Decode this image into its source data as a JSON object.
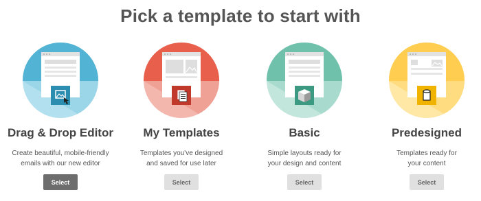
{
  "heading": "Pick a template to start with",
  "cards": [
    {
      "title": "Drag & Drop Editor",
      "desc_line1": "Create beautiful, mobile-friendly",
      "desc_line2": "emails with our new editor",
      "button": "Select",
      "icon": "image-picture-icon",
      "color_dark": "#52b3d4",
      "color_light": "#b2e0ef",
      "color_badge": "#2b8db0",
      "active": true
    },
    {
      "title": "My Templates",
      "desc_line1": "Templates you've designed",
      "desc_line2": "and saved for use later",
      "button": "Select",
      "icon": "documents-stack-icon",
      "color_dark": "#e8604c",
      "color_light": "#f3b7ae",
      "color_badge": "#c0392b",
      "active": false
    },
    {
      "title": "Basic",
      "desc_line1": "Simple layouts ready for",
      "desc_line2": "your design and content",
      "button": "Select",
      "icon": "cube-icon",
      "color_dark": "#6fc1ac",
      "color_light": "#c3e6dc",
      "color_badge": "#3d9a82",
      "active": false
    },
    {
      "title": "Predesigned",
      "desc_line1": "Templates ready for",
      "desc_line2": "your content",
      "button": "Select",
      "icon": "cylinder-icon",
      "color_dark": "#ffcd4f",
      "color_light": "#ffe7a6",
      "color_badge": "#f0b400",
      "active": false
    }
  ]
}
